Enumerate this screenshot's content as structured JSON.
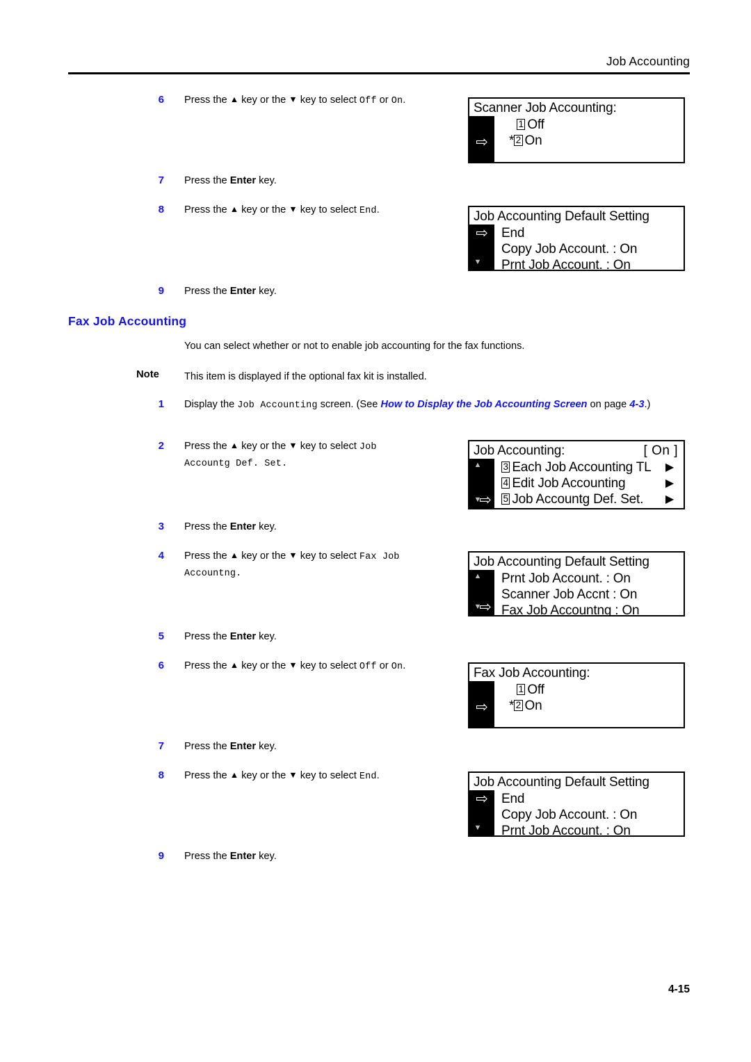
{
  "header": {
    "title": "Job Accounting"
  },
  "footer": {
    "page_number": "4-15"
  },
  "section": {
    "heading": "Fax Job Accounting",
    "intro": "You can select whether or not to enable job accounting for the fax functions.",
    "note_label": "Note",
    "note_text": "This item is displayed if the optional fax kit is installed."
  },
  "steps": {
    "top6": {
      "num": "6",
      "press_the": "Press the ",
      "key_or_the": " key or the ",
      "key_to_select": " key to select ",
      "opt_a": "Off",
      "or": " or ",
      "opt_b": "On",
      "end": "."
    },
    "top7": {
      "num": "7",
      "text_before": "Press the ",
      "key_name": "Enter",
      "text_after": " key."
    },
    "top8": {
      "num": "8",
      "press_the": "Press the ",
      "key_or_the": " key or the ",
      "key_to_select": " key to select ",
      "target": "End",
      "end": "."
    },
    "top9": {
      "num": "9",
      "text_before": "Press the ",
      "key_name": "Enter",
      "text_after": " key."
    },
    "s1": {
      "num": "1",
      "display_the": "Display the ",
      "screen_name": "Job Accounting",
      "screen_word": " screen. (See ",
      "xref": "How to Display the Job Accounting Screen",
      "on_word": " on page ",
      "page_ref": "4-3",
      "close": ".)"
    },
    "s2": {
      "num": "2",
      "press_the": "Press the ",
      "key_or_the": " key or the ",
      "key_to_select": " key to select ",
      "target_line1": "Job",
      "target_line2": "Accountg Def. Set."
    },
    "s3": {
      "num": "3",
      "text_before": "Press the ",
      "key_name": "Enter",
      "text_after": " key."
    },
    "s4": {
      "num": "4",
      "press_the": "Press the ",
      "key_or_the": " key or the ",
      "key_to_select": " key to select ",
      "target_line1": "Fax Job",
      "target_line2": "Accountng."
    },
    "s5": {
      "num": "5",
      "text_before": "Press the ",
      "key_name": "Enter",
      "text_after": " key."
    },
    "s6": {
      "num": "6",
      "press_the": "Press the ",
      "key_or_the": " key or the ",
      "key_to_select": " key to select ",
      "opt_a": "Off",
      "or": " or ",
      "opt_b": "On",
      "end": "."
    },
    "s7": {
      "num": "7",
      "text_before": "Press the ",
      "key_name": "Enter",
      "text_after": " key."
    },
    "s8": {
      "num": "8",
      "press_the": "Press the ",
      "key_or_the": " key or the ",
      "key_to_select": " key to select ",
      "target": "End",
      "end": "."
    },
    "s9": {
      "num": "9",
      "text_before": "Press the ",
      "key_name": "Enter",
      "text_after": " key."
    }
  },
  "glyphs": {
    "up_key": "▲",
    "down_key": "▼",
    "cursor_arrow": "⇨",
    "scroll_up": "▲",
    "scroll_down": "▼",
    "row_arrow": "▶",
    "star": "*"
  },
  "lcd_panels": {
    "scanner_job_accounting": {
      "title": "Scanner Job Accounting:",
      "rows": [
        {
          "star": "",
          "num": "1",
          "label": "Off"
        },
        {
          "star": "*",
          "num": "2",
          "label": "On"
        }
      ]
    },
    "job_accounting_default_setting_1": {
      "title": "Job Accounting Default Setting",
      "rows": [
        {
          "label": "End"
        },
        {
          "label": "Copy Job Account. : On"
        },
        {
          "label": "Prnt Job Account.  : On"
        }
      ]
    },
    "job_accounting_menu": {
      "title": "Job Accounting:",
      "badge": "[ On ]",
      "rows": [
        {
          "num": "3",
          "label": "Each Job Accounting TL"
        },
        {
          "num": "4",
          "label": "Edit Job Accounting"
        },
        {
          "num": "5",
          "label": "Job Accountg Def. Set."
        }
      ]
    },
    "job_accounting_default_setting_2": {
      "title": "Job Accounting Default Setting",
      "rows": [
        {
          "label": "Prnt Job Account.   : On"
        },
        {
          "label": "Scanner Job Accnt  : On"
        },
        {
          "label": "Fax Job Accountng  : On"
        }
      ]
    },
    "fax_job_accounting": {
      "title": "Fax Job Accounting:",
      "rows": [
        {
          "star": "",
          "num": "1",
          "label": "Off"
        },
        {
          "star": "*",
          "num": "2",
          "label": "On"
        }
      ]
    },
    "job_accounting_default_setting_3": {
      "title": "Job Accounting Default Setting",
      "rows": [
        {
          "label": "End"
        },
        {
          "label": "Copy Job Account. : On"
        },
        {
          "label": "Prnt Job Account.  : On"
        }
      ]
    }
  }
}
